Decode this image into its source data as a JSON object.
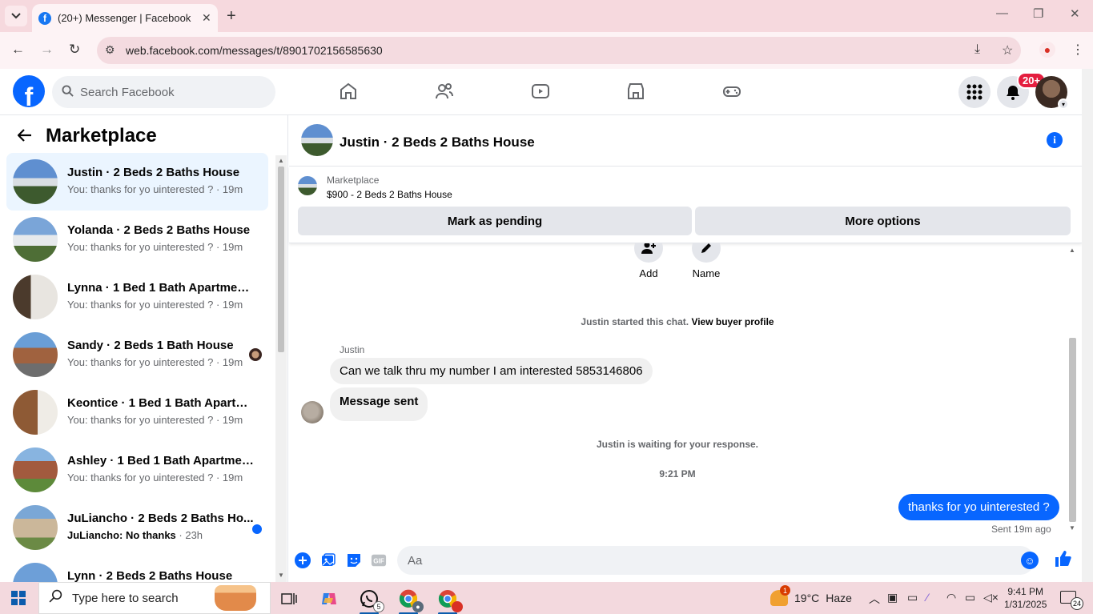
{
  "browser": {
    "tab_title": "(20+) Messenger | Facebook",
    "url": "web.facebook.com/messages/t/8901702156585630"
  },
  "fb_header": {
    "search_placeholder": "Search Facebook",
    "notification_badge": "20+"
  },
  "sidebar": {
    "title": "Marketplace",
    "conversations": [
      {
        "name": "Justin · 2 Beds 2 Baths House",
        "snippet": "You: thanks for yo uinterested ? · 19m",
        "active": true
      },
      {
        "name": "Yolanda · 2 Beds 2 Baths House",
        "snippet": "You: thanks for yo uinterested ? · 19m"
      },
      {
        "name": "Lynna · 1 Bed 1 Bath Apartment/...",
        "snippet": "You: thanks for yo uinterested ? · 19m"
      },
      {
        "name": "Sandy · 2 Beds 1 Bath House",
        "snippet": "You: thanks for yo uinterested ? · 19m"
      },
      {
        "name": "Keontice · 1 Bed 1 Bath Apartme...",
        "snippet": "You: thanks for yo uinterested ? · 19m"
      },
      {
        "name": "Ashley · 1 Bed 1 Bath Apartment...",
        "snippet": "You: thanks for yo uinterested ? · 19m"
      },
      {
        "name": "JuLiancho · 2 Beds 2 Baths Ho...",
        "snippet_bold": "JuLiancho: No thanks",
        "snippet_time": " · 23h"
      },
      {
        "name": "Lynn · 2 Beds 2 Baths House",
        "snippet": ""
      }
    ]
  },
  "chat": {
    "title": "Justin · 2 Beds 2 Baths House",
    "listing_category": "Marketplace",
    "listing_price": "$900 - 2 Beds 2 Baths House",
    "mark_pending_label": "Mark as pending",
    "more_options_label": "More options",
    "add_label": "Add",
    "name_label": "Name",
    "started_text": "Justin started this chat.",
    "view_profile_label": "View buyer profile",
    "sender_name": "Justin",
    "message_1": "Can we talk thru my number I am interested 5853146806",
    "message_2": "Message sent",
    "waiting_text": "Justin is waiting for your response.",
    "time_divider": "9:21 PM",
    "outgoing_message": "thanks for yo uinterested ?",
    "sent_status": "Sent 19m ago",
    "composer_placeholder": "Aa"
  },
  "taskbar": {
    "search_placeholder": "Type here to search",
    "whatsapp_count": "5",
    "weather_alert": "1",
    "temperature": "19°C",
    "weather_condition": "Haze",
    "time": "9:41 PM",
    "date": "1/31/2025",
    "notification_count": "24"
  },
  "colors": {
    "fb_blue": "#0866ff",
    "browser_pink": "#f6d9de",
    "active_conv": "#ebf5ff"
  }
}
